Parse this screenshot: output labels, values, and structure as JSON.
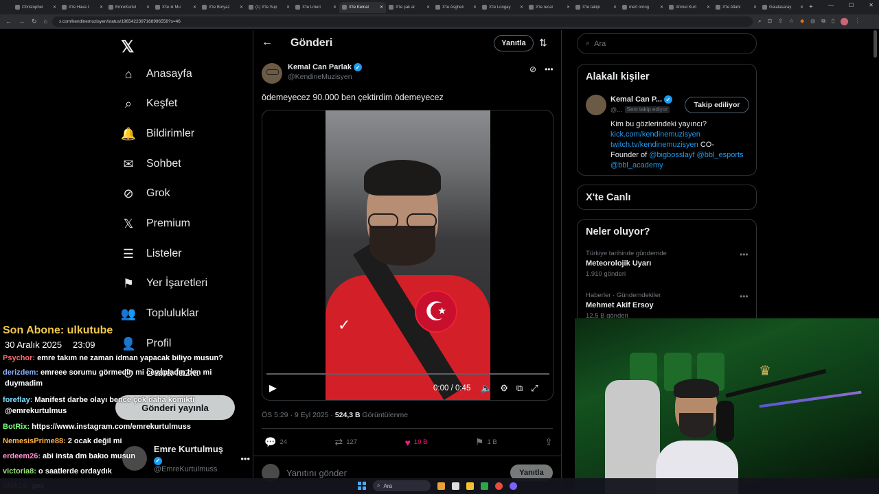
{
  "browser": {
    "tabs": [
      {
        "label": "Christopher"
      },
      {
        "label": "X'te Hava I."
      },
      {
        "label": "EmreKurtul"
      },
      {
        "label": "X'te ❄ Mu"
      },
      {
        "label": "X'te Boryaz"
      },
      {
        "label": "(1) X'te Sup"
      },
      {
        "label": "X'te Lmeri"
      },
      {
        "label": "X'te Kemal"
      },
      {
        "label": "X'te şak ar"
      },
      {
        "label": "X'te Asghen"
      },
      {
        "label": "X'te Longay"
      },
      {
        "label": "X'te recai"
      },
      {
        "label": "X'te takipi"
      },
      {
        "label": "mert ornog"
      },
      {
        "label": "Ahmet Kurt"
      },
      {
        "label": "X'te Allahi"
      },
      {
        "label": "Galatasaray"
      }
    ],
    "active_tab_index": 7,
    "url": "x.com/kendinemuzisyen/status/1965422397168996558?s=46"
  },
  "nav": {
    "items": [
      {
        "label": "Anasayfa",
        "icon": "home-icon",
        "glyph": "⌂"
      },
      {
        "label": "Keşfet",
        "icon": "search-icon",
        "glyph": "⌕"
      },
      {
        "label": "Bildirimler",
        "icon": "bell-icon",
        "glyph": "🔔"
      },
      {
        "label": "Sohbet",
        "icon": "mail-icon",
        "glyph": "✉"
      },
      {
        "label": "Grok",
        "icon": "grok-icon",
        "glyph": "⊘"
      },
      {
        "label": "Premium",
        "icon": "x-icon",
        "glyph": "𝕏"
      },
      {
        "label": "Listeler",
        "icon": "list-icon",
        "glyph": "☰"
      },
      {
        "label": "Yer İşaretleri",
        "icon": "bookmark-icon",
        "glyph": "⚑"
      },
      {
        "label": "Topluluklar",
        "icon": "people-icon",
        "glyph": "👥"
      },
      {
        "label": "Profil",
        "icon": "person-icon",
        "glyph": "👤"
      }
    ],
    "post_button": "Gönderi yayınla",
    "profile": {
      "name": "Emre Kurtulmuş",
      "handle": "@EmreKurtulmuss"
    }
  },
  "main": {
    "header_title": "Gönderi",
    "reply_button": "Yanıtla",
    "author": {
      "name": "Kemal Can Parlak",
      "handle": "@KendineMuzisyen"
    },
    "text": "ödemeyecez 90.000 ben çektirdim ödemeyecez",
    "video": {
      "time": "0:00 / 0:45",
      "progress": 0
    },
    "meta": {
      "time": "ÖS 5:29 · 9 Eyl 2025 · ",
      "views": "524,3 B",
      "views_label": " Görüntülenme"
    },
    "stats": {
      "replies": "24",
      "reposts": "127",
      "likes": "10 B",
      "bookmarks": "1 B"
    },
    "reply_placeholder": "Yanıtını gönder",
    "reply_submit": "Yanıtla"
  },
  "right": {
    "search_placeholder": "Ara",
    "relevant_title": "Alakalı kişiler",
    "relevant": {
      "name": "Kemal Can P...",
      "handle": "@...",
      "follows_you": "Seni takip ediyor",
      "follow_button": "Takip ediliyor",
      "bio_line1": "Kim bu gözlerindeki yayıncı?",
      "bio_link1": "kick.com/kendinemuzisyen",
      "bio_link2": "twitch.tv/kendinemuzisyen",
      "bio_text2": " CO-",
      "bio_text3": "Founder of ",
      "bio_mention1": "@bigbosslayf",
      "bio_mention2": "@bbl_esports",
      "bio_mention3": "@bbl_academy"
    },
    "live_title": "X'te Canlı",
    "trends_title": "Neler oluyor?",
    "trends": [
      {
        "category": "Türkiye tarihinde gündemde",
        "title": "Meteorolojik Uyarı",
        "count": "1.910 gönderi"
      },
      {
        "category": "Haberler · Gündemdekiler",
        "title": "Mehmet Akif Ersoy",
        "count": "12,5 B gönderi"
      }
    ]
  },
  "overlay": {
    "sub_title": "Son Abone: ulkutube",
    "sub_date": "30 Aralık 2025",
    "sub_time": "23:09",
    "chat": [
      {
        "user": "Psychor:",
        "color": "#ff6b6b",
        "text": "emre takım ne zaman idman yapacak biliyo musun?"
      },
      {
        "user": "derizdem:",
        "color": "#8ab4ff",
        "text": "emreee sorumu görmedin mi cevapladın ben mi"
      },
      {
        "user": "",
        "color": "#ffffff",
        "text": "duymadim"
      },
      {
        "user": "foreflay:",
        "color": "#7ee0ff",
        "text": "Manifest darbe olayı bence çok daha komikti"
      },
      {
        "user": "",
        "color": "#ffffff",
        "text": "@emrekurtulmus"
      },
      {
        "user": "BotRix:",
        "color": "#7CFC7C",
        "text": "https://www.instagram.com/emrekurtulmuss"
      },
      {
        "user": "NemesisPrime88:",
        "color": "#ffb347",
        "text": "2 ocak değil mi"
      },
      {
        "user": "erdeem26:",
        "color": "#ff8fd0",
        "text": "abi insta dm bakıo musun"
      },
      {
        "user": "victoria8:",
        "color": "#9be37b",
        "text": "o saatlerde ordaydık"
      },
      {
        "user": "ölük19:",
        "color": "#ff5f5f",
        "text": "geç"
      }
    ],
    "nav_more": "Daha fazla"
  },
  "taskbar": {
    "search": "Ara"
  }
}
